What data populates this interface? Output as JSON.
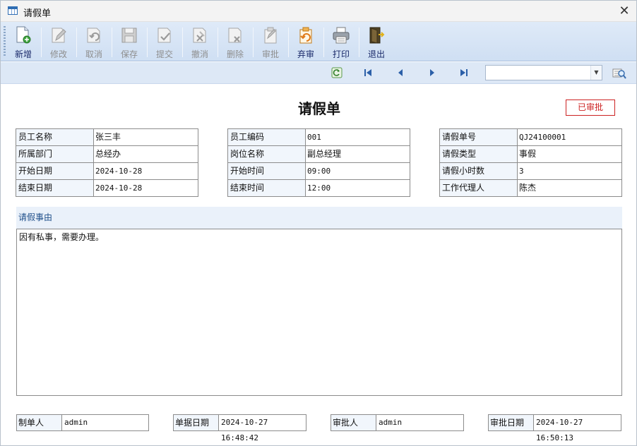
{
  "window": {
    "title": "请假单",
    "close_glyph": "✕"
  },
  "toolbar": {
    "buttons": [
      {
        "label": "新增",
        "icon": "new-document-icon",
        "enabled": true
      },
      {
        "label": "修改",
        "icon": "edit-icon",
        "enabled": false
      },
      {
        "label": "取消",
        "icon": "undo-icon",
        "enabled": false
      },
      {
        "label": "保存",
        "icon": "save-icon",
        "enabled": false
      },
      {
        "label": "提交",
        "icon": "submit-icon",
        "enabled": false
      },
      {
        "label": "撤消",
        "icon": "revoke-icon",
        "enabled": false
      },
      {
        "label": "删除",
        "icon": "delete-icon",
        "enabled": false
      },
      {
        "label": "审批",
        "icon": "approve-icon",
        "enabled": false
      },
      {
        "label": "弃审",
        "icon": "unapprove-icon",
        "enabled": true
      },
      {
        "label": "打印",
        "icon": "printer-icon",
        "enabled": true
      },
      {
        "label": "退出",
        "icon": "exit-door-icon",
        "enabled": true
      }
    ]
  },
  "navbar": {
    "search_value": "",
    "icons": [
      "refresh-icon",
      "first-record-icon",
      "previous-record-icon",
      "next-record-icon",
      "last-record-icon",
      "find-icon"
    ]
  },
  "form": {
    "title": "请假单",
    "status": "已审批",
    "group1": [
      {
        "label": "员工名称",
        "value": "张三丰"
      },
      {
        "label": "所属部门",
        "value": "总经办"
      },
      {
        "label": "开始日期",
        "value": "2024-10-28"
      },
      {
        "label": "结束日期",
        "value": "2024-10-28"
      }
    ],
    "group2": [
      {
        "label": "员工编码",
        "value": "001"
      },
      {
        "label": "岗位名称",
        "value": "副总经理"
      },
      {
        "label": "开始时间",
        "value": "09:00"
      },
      {
        "label": "结束时间",
        "value": "12:00"
      }
    ],
    "group3": [
      {
        "label": "请假单号",
        "value": "QJ24100001"
      },
      {
        "label": "请假类型",
        "value": "事假"
      },
      {
        "label": "请假小时数",
        "value": "3"
      },
      {
        "label": "工作代理人",
        "value": "陈杰"
      }
    ],
    "reason_label": "请假事由",
    "reason_text": "因有私事，需要办理。"
  },
  "footer": {
    "creator_label": "制单人",
    "creator": "admin",
    "doc_date_label": "单据日期",
    "doc_date": "2024-10-27 16:48:42",
    "approver_label": "审批人",
    "approver": "admin",
    "approve_date_label": "审批日期",
    "approve_date": "2024-10-27 16:50:13"
  }
}
